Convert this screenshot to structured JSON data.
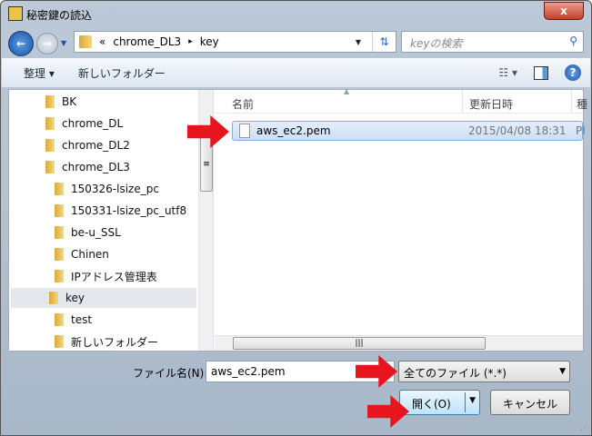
{
  "window": {
    "title": "秘密鍵の読込",
    "close_label": "x"
  },
  "address": {
    "overflow": "«",
    "crumbs": [
      "chrome_DL3",
      "key"
    ],
    "separator": "▸"
  },
  "search": {
    "placeholder": "keyの検索"
  },
  "toolbar": {
    "organize": "整理 ▾",
    "new_folder": "新しいフォルダー",
    "help": "?"
  },
  "tree": {
    "items": [
      {
        "label": "BK",
        "level": 0
      },
      {
        "label": "chrome_DL",
        "level": 0
      },
      {
        "label": "chrome_DL2",
        "level": 0
      },
      {
        "label": "chrome_DL3",
        "level": 0
      },
      {
        "label": "150326-lsize_pc",
        "level": 1
      },
      {
        "label": "150331-lsize_pc_utf8",
        "level": 1
      },
      {
        "label": "be-u_SSL",
        "level": 1
      },
      {
        "label": "Chinen",
        "level": 1
      },
      {
        "label": "IPアドレス管理表",
        "level": 1
      },
      {
        "label": "key",
        "level": 1,
        "selected": true
      },
      {
        "label": "test",
        "level": 1
      },
      {
        "label": "新しいフォルダー",
        "level": 1
      }
    ]
  },
  "list": {
    "columns": [
      "名前",
      "更新日時",
      "種"
    ],
    "files": [
      {
        "name": "aws_ec2.pem",
        "modified": "2015/04/08 18:31",
        "type": "PI"
      }
    ]
  },
  "footer": {
    "filename_label": "ファイル名(N):",
    "filename_value": "aws_ec2.pem",
    "filetype": "全てのファイル (*.*)",
    "open": "開く(O)",
    "cancel": "キャンセル"
  }
}
